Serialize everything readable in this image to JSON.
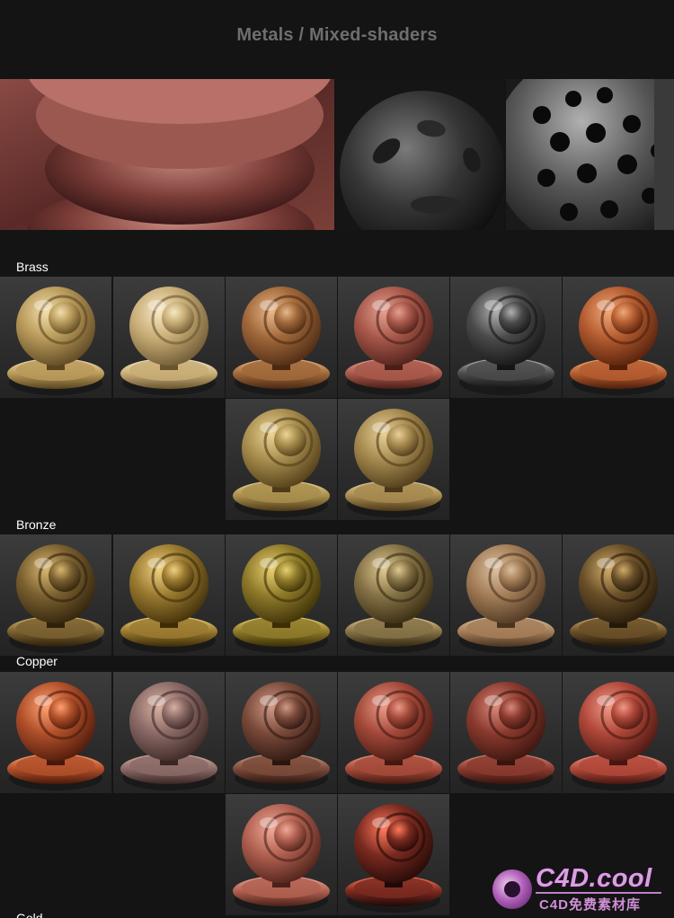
{
  "title": "Metals / Mixed-shaders",
  "hero_images": [
    {
      "name": "hammered-copper-render",
      "colors": [
        "#6a3530",
        "#a86a62",
        "#3c1c1a"
      ]
    },
    {
      "name": "dark-iron-studs-render",
      "colors": [
        "#262626",
        "#6a6a6a",
        "#0c0c0c"
      ]
    },
    {
      "name": "perforated-steel-render",
      "colors": [
        "#303030",
        "#9a9a9a",
        "#101010"
      ]
    }
  ],
  "sections": [
    {
      "label": "Brass",
      "rows": [
        [
          {
            "base": "#b89a5a",
            "light": "#f2deaa",
            "dark": "#5a4420"
          },
          {
            "base": "#c8ad76",
            "light": "#f7e8c4",
            "dark": "#6a5530"
          },
          {
            "base": "#a0683a",
            "light": "#e8b888",
            "dark": "#4a2812"
          },
          {
            "base": "#a8584a",
            "light": "#e4a090",
            "dark": "#4a1e18"
          },
          {
            "base": "#4a4a4a",
            "light": "#b0b0b0",
            "dark": "#141414"
          },
          {
            "base": "#b45c30",
            "light": "#f0a878",
            "dark": "#501e0a"
          }
        ],
        [
          null,
          null,
          {
            "base": "#a88e4e",
            "light": "#ecd494",
            "dark": "#4e3a16"
          },
          {
            "base": "#a68a50",
            "light": "#e8cf98",
            "dark": "#4c3818"
          },
          null,
          null
        ]
      ]
    },
    {
      "label": "Bronze",
      "rows": [
        [
          {
            "base": "#7a6030",
            "light": "#d8b670",
            "dark": "#2e200a"
          },
          {
            "base": "#9a7a30",
            "light": "#f0d080",
            "dark": "#3e2c08"
          },
          {
            "base": "#8e7a2a",
            "light": "#e8d070",
            "dark": "#3a2e06"
          },
          {
            "base": "#857246",
            "light": "#e0c890",
            "dark": "#342810"
          },
          {
            "base": "#a47e58",
            "light": "#dcc0a0",
            "dark": "#4a3420"
          },
          {
            "base": "#6a5028",
            "light": "#d0aa6a",
            "dark": "#24180a"
          }
        ]
      ]
    },
    {
      "label": "Copper",
      "rows": [
        [
          {
            "base": "#b0502a",
            "light": "#ffa070",
            "dark": "#4a180a"
          },
          {
            "base": "#8a6a66",
            "light": "#d8b0a0",
            "dark": "#3a2624"
          },
          {
            "base": "#7a4a3a",
            "light": "#d09a88",
            "dark": "#2a1610"
          },
          {
            "base": "#a44a3a",
            "light": "#ea9a88",
            "dark": "#441810"
          },
          {
            "base": "#8a3a2e",
            "light": "#d8887a",
            "dark": "#38140e"
          },
          {
            "base": "#b0483a",
            "light": "#f09888",
            "dark": "#481610"
          }
        ],
        [
          null,
          null,
          {
            "base": "#b06050",
            "light": "#f0a898",
            "dark": "#4a2018"
          },
          {
            "base": "#7a2a20",
            "light": "#ff7a5a",
            "dark": "#200806"
          },
          null,
          null
        ]
      ]
    }
  ],
  "next_section_partial_label": "Gold",
  "watermark": {
    "logo_text": "C4D.cool",
    "sub_text": "C4D免费素材库",
    "colors": {
      "primary": "#d8a0e0",
      "accent": "#b060b8"
    }
  }
}
